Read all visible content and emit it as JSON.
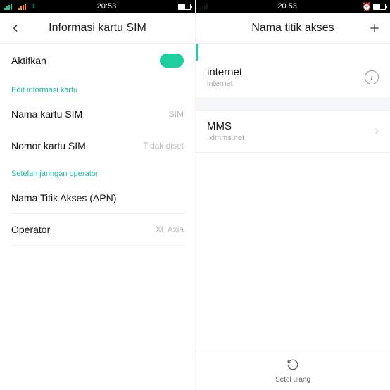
{
  "screen_left": {
    "status": {
      "time": "20:53"
    },
    "header": {
      "title": "Informasi kartu SIM"
    },
    "enable": {
      "label": "Aktifkan"
    },
    "section_edit": "Edit informasi kartu",
    "rows": {
      "sim_name": {
        "label": "Nama kartu SIM",
        "value": "SIM"
      },
      "sim_number": {
        "label": "Nomor kartu SIM",
        "value": "Tidak diset"
      }
    },
    "section_net": "Setelan jaringan operator",
    "apn": {
      "label": "Nama Titik Akses (APN)"
    },
    "operator": {
      "label": "Operator",
      "value": "XL Axia"
    }
  },
  "screen_right": {
    "status": {
      "time": "20.53"
    },
    "header": {
      "title": "Nama titik akses"
    },
    "apns": {
      "0": {
        "name": "internet",
        "apn": "internet"
      },
      "1": {
        "name": "MMS",
        "apn": ".xlmms.net"
      }
    },
    "footer": {
      "label": "Setel ulang"
    }
  }
}
